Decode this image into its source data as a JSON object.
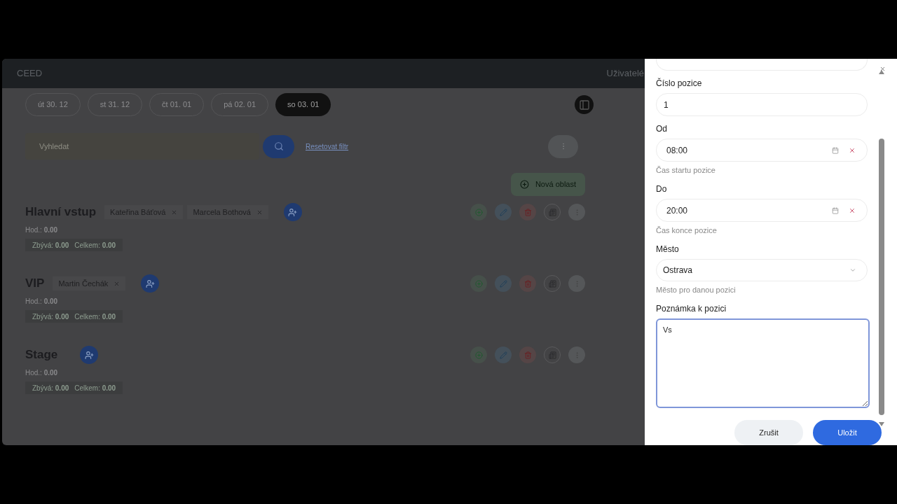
{
  "app": {
    "brand": "CEED",
    "nav_link": "Uživatelé"
  },
  "days": [
    {
      "label": "út 30. 12",
      "selected": false
    },
    {
      "label": "st 31. 12",
      "selected": false
    },
    {
      "label": "čt 01. 01",
      "selected": false
    },
    {
      "label": "pá 02. 01",
      "selected": false
    },
    {
      "label": "so 03. 01",
      "selected": true
    }
  ],
  "search": {
    "placeholder": "Vyhledat"
  },
  "reset_link": "Resetovat filtr",
  "new_area_button": "Nová oblast",
  "areas": [
    {
      "name": "Hlavní vstup",
      "people": [
        "Kateřina Báťová",
        "Marcela Bothová"
      ],
      "hours": "Hod.: **0.00**",
      "remaining": "Zbývá: **0.00**",
      "total": "Celkem: **0.00**"
    },
    {
      "name": "VIP",
      "people": [
        "Martin Čechák"
      ],
      "hours": "Hod.: **0.00**",
      "remaining": "Zbývá: **0.00**",
      "total": "Celkem: **0.00**"
    },
    {
      "name": "Stage",
      "hours": "Hod.: **0.00**",
      "remaining": "Zbývá: **0.00**",
      "total": "Celkem: **0.00**"
    }
  ],
  "drawer": {
    "fields": [
      {
        "kind": "text",
        "label": "Číslo pozice",
        "value": "1"
      },
      {
        "kind": "time",
        "label": "Od",
        "value": "08:00",
        "help": "Čas startu pozice"
      },
      {
        "kind": "time",
        "label": "Do",
        "value": "20:00",
        "help": "Čas konce pozice"
      },
      {
        "kind": "select",
        "label": "Město",
        "value": "Ostrava",
        "help": "Město pro danou pozici"
      },
      {
        "kind": "textarea",
        "label": "Poznámka k pozici",
        "value": "Vs",
        "focused": true
      }
    ],
    "buttons": [
      {
        "label": "Zrušit",
        "kind": "secondary"
      },
      {
        "label": "Uložit",
        "kind": "primary"
      }
    ]
  }
}
